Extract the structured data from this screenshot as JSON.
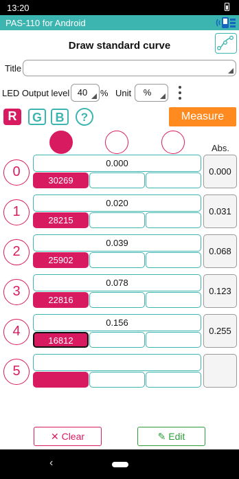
{
  "status": {
    "time": "13:20"
  },
  "app": {
    "title": "PAS-110 for Android"
  },
  "header": {
    "title": "Draw standard curve"
  },
  "title_field": {
    "label": "Title",
    "value": ""
  },
  "led": {
    "label": "LED Output level",
    "value": "40",
    "percent": "%",
    "unit_label": "Unit",
    "unit_value": "%"
  },
  "channels": {
    "r": "R",
    "g": "G",
    "b": "B",
    "help": "?"
  },
  "measure_label": "Measure",
  "abs_header": "Abs.",
  "rows": [
    {
      "index": "0",
      "concentration": "0.000",
      "counts": "30269",
      "abs": "0.000"
    },
    {
      "index": "1",
      "concentration": "0.020",
      "counts": "28215",
      "abs": "0.031"
    },
    {
      "index": "2",
      "concentration": "0.039",
      "counts": "25902",
      "abs": "0.068"
    },
    {
      "index": "3",
      "concentration": "0.078",
      "counts": "22816",
      "abs": "0.123"
    },
    {
      "index": "4",
      "concentration": "0.156",
      "counts": "16812",
      "abs": "0.255"
    },
    {
      "index": "5",
      "concentration": "",
      "counts": "",
      "abs": ""
    }
  ],
  "buttons": {
    "clear": "Clear",
    "edit": "Edit"
  },
  "colors": {
    "accent": "#3cb5b0",
    "red": "#d81b60",
    "orange": "#ff8a1f",
    "green": "#2e9d3a"
  }
}
